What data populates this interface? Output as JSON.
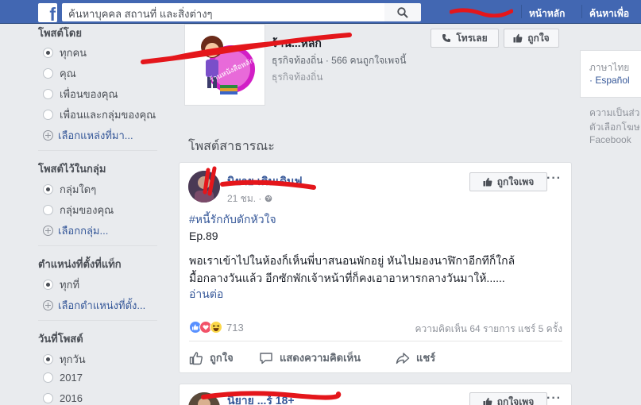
{
  "search": {
    "placeholder": "ค้นหาบุคคล สถานที่ และสิ่งต่างๆ"
  },
  "top_nav": {
    "home": "หน้าหลัก",
    "find_friends": "ค้นหาเพื่อ"
  },
  "filters": {
    "posted_by": {
      "title": "โพสต์โดย",
      "options": [
        "ทุกคน",
        "คุณ",
        "เพื่อนของคุณ",
        "เพื่อนและกลุ่มของคุณ"
      ],
      "choose": "เลือกแหล่งที่มา..."
    },
    "posted_in_group": {
      "title": "โพสต์ไว้ในกลุ่ม",
      "options": [
        "กลุ่มใดๆ",
        "กลุ่มของคุณ"
      ],
      "choose": "เลือกกลุ่ม..."
    },
    "tagged_location": {
      "title": "ตำแหน่งที่ตั้งที่แท็ก",
      "options": [
        "ทุกที่"
      ],
      "choose": "เลือกตำแหน่งที่ตั้ง..."
    },
    "date_posted": {
      "title": "วันที่โพสต์",
      "options": [
        "ทุกวัน",
        "2017",
        "2016"
      ]
    }
  },
  "page": {
    "name": "ร้าน...หลัก",
    "meta": "ธุรกิจท้องถิ่น · 566 คนถูกใจเพจนี้",
    "category": "ธุรกิจท้องถิ่น",
    "call_button": "โทรเลย",
    "like_button": "ถูกใจ",
    "logo_text": "ร้านหนังสือหลัก"
  },
  "section_title": "โพสต์สาธารณะ",
  "post": {
    "author": "นิยาย เดินเดินฟ",
    "time": "21 ชม. · ",
    "like_page_button": "ถูกใจเพจ",
    "hashtag": "#หนี้รักกับดักหัวใจ",
    "episode": "Ep.89",
    "line1": "พอเราเข้าไปในห้องก็เห็นพี่บาสนอนพักอยู่ หันไปมองนาฬิกาอีกทีก็ใกล้",
    "line2": "มื้อกลางวันแล้ว อีกซักพักเจ้าหน้าที่ก็คงเอาอาหารกลางวันมาให้......",
    "read_more": "อ่านต่อ",
    "reactions_count": "713",
    "stats": "ความคิดเห็น 64 รายการ  แชร์ 5 ครั้ง",
    "actions": {
      "like": "ถูกใจ",
      "comment": "แสดงความคิดเห็น",
      "share": "แชร์"
    }
  },
  "post2": {
    "author": "นิยาย ...ร์ 18+",
    "like_page_button": "ถูกใจเพจ"
  },
  "right": {
    "lang_title": "ภาษาไทย",
    "lang_link": "· Español",
    "privacy_lines": [
      "ความเป็นส่ว",
      "ตัวเลือกโฆษ",
      "Facebook"
    ]
  },
  "colors": {
    "brand": "#4267b2",
    "link": "#365899",
    "scribble": "#e4161b"
  }
}
